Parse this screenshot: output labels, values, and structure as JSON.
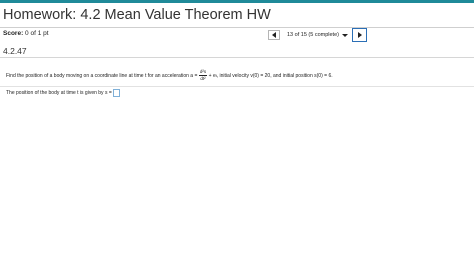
{
  "header": {
    "title": "Homework: 4.2 Mean Value Theorem HW",
    "accent_color": "#1f8a99"
  },
  "score": {
    "label": "Score:",
    "value": "0 of 1 pt"
  },
  "navigation": {
    "prev_icon": "triangle-left-icon",
    "progress": "13 of 15 (5 complete)",
    "dropdown_icon": "triangle-down-icon",
    "next_icon": "triangle-right-icon"
  },
  "question": {
    "number": "4.2.47",
    "text_before": "Find the position of a body moving on a coordinate line at time t for an acceleration a =",
    "frac_num": "d²s",
    "frac_den": "dt²",
    "text_mid": "+ e",
    "exponent": "t",
    "text_after": ", initial velocity v(0) = 20, and initial position s(0) = 6."
  },
  "answer": {
    "prompt": "The position of the body at time t is given by s =",
    "value": ""
  }
}
